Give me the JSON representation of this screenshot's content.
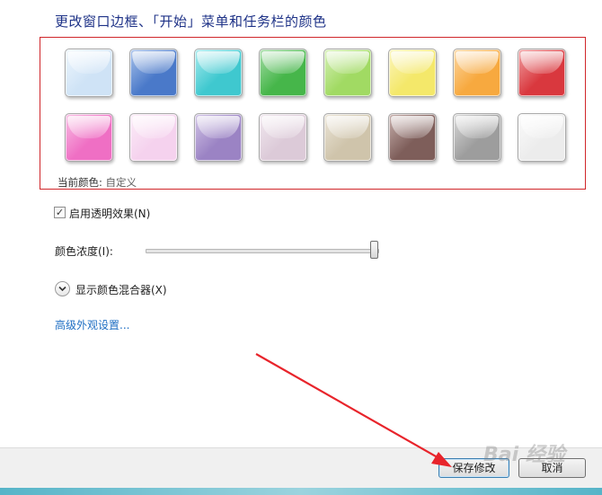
{
  "title": "更改窗口边框、「开始」菜单和任务栏的颜色",
  "swatches": [
    {
      "color": "#cfe3f6",
      "glow": "#eef6fd"
    },
    {
      "color": "#4a79c9",
      "glow": "#a9c2ea"
    },
    {
      "color": "#3fc8cf",
      "glow": "#a8ebee"
    },
    {
      "color": "#46b64a",
      "glow": "#a4dca5"
    },
    {
      "color": "#a1da63",
      "glow": "#d6f0b8"
    },
    {
      "color": "#f4e86a",
      "glow": "#fbf5bd"
    },
    {
      "color": "#f7a93f",
      "glow": "#fcd7a3"
    },
    {
      "color": "#d9383e",
      "glow": "#f0a0a2"
    },
    {
      "color": "#ef6fc4",
      "glow": "#f9bfe4"
    },
    {
      "color": "#f5d2ee",
      "glow": "#fcedf8"
    },
    {
      "color": "#9b83c4",
      "glow": "#d2c5e6"
    },
    {
      "color": "#dccad8",
      "glow": "#f1e8ef"
    },
    {
      "color": "#cfc4ab",
      "glow": "#ebe5d8"
    },
    {
      "color": "#7e5e5a",
      "glow": "#c6afac"
    },
    {
      "color": "#9d9d9d",
      "glow": "#d9d9d9"
    },
    {
      "color": "#ececec",
      "glow": "#fbfbfb"
    }
  ],
  "current_color_label": "当前颜色:",
  "current_color_value": "自定义",
  "transparency_label": "启用透明效果(N)",
  "transparency_checked": true,
  "intensity_label": "颜色浓度(I):",
  "intensity_value": 1.0,
  "mixer_label": "显示颜色混合器(X)",
  "advanced_link": "高级外观设置...",
  "save_button": "保存修改",
  "cancel_button": "取消",
  "watermark_text": "Bai 经验"
}
